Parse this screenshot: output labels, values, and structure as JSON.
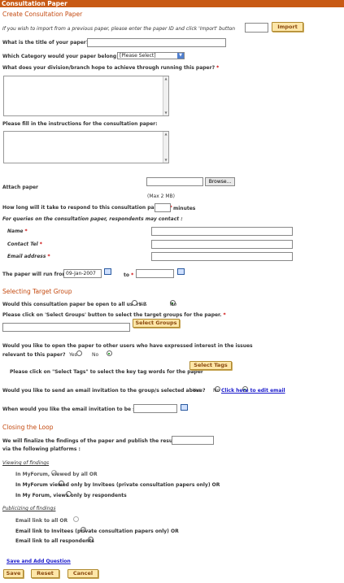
{
  "window": {
    "title": "Consultation Paper"
  },
  "header": {
    "title": "Create Consultation Paper"
  },
  "import": {
    "prompt": "If you wish to import from a previous paper, please enter the paper ID and click 'Import' button",
    "button": "Import"
  },
  "title_q": {
    "label": "What is the title of your paper?",
    "req": "*"
  },
  "category": {
    "label": "Which Category would your paper belong to?",
    "req": "*",
    "selected": "[Please Select]"
  },
  "achieve": {
    "label": "What does your division/branch hope to achieve through running this paper?",
    "req": "*"
  },
  "instructions": {
    "label": "Please fill in the instructions for the consultation paper:"
  },
  "attach": {
    "label": "Attach paper",
    "browse": "Browse...",
    "max": "(Max 2 MB)"
  },
  "respond": {
    "label": "How long will it take to respond to this consultation paper ?",
    "req": "*",
    "unit": "minutes"
  },
  "contact": {
    "intro": "For queries on the consultation paper, respondents may contact :",
    "name": "Name",
    "tel": "Contact Tel",
    "email": "Email address",
    "req": "*"
  },
  "run": {
    "from_label": "The paper will run from",
    "req": "*",
    "from_value": "09-Jan-2007",
    "to_label": "to"
  },
  "target": {
    "title": "Selecting Target Group",
    "open_q": "Would this consultation paper be open to all users ?",
    "yes": "Yes",
    "no": "No",
    "select_groups_prompt": "Please click on 'Select Groups' button to select the target groups for the paper.",
    "req": "*",
    "select_groups_btn": "Select Groups",
    "other_users_q1": "Would you like to open the paper to other users who have expressed interest in the issues",
    "other_users_q2": "relevant to this paper?",
    "select_tags_prompt": "Please click on \"Select Tags\" to select the key tag words for the paper",
    "select_tags_btn": "Select Tags",
    "email_inv_q": "Would you like to send an email invitation to the group/s selected above?",
    "edit_email": "Click here to edit email",
    "email_when": "When would you like the email invitation to be sent ?"
  },
  "closing": {
    "title": "Closing the Loop",
    "finalize_1": "We will finalize the findings of the paper and publish the results by",
    "req": "*",
    "finalize_2": "via the following platforms :",
    "viewing_title": "Viewing of findings",
    "viewing": [
      "In MyForum, viewed by all OR",
      "In MyForum viewed only by Invitees (private consultation papers only) OR",
      "In My Forum, views only by respondents"
    ],
    "publicizing_title": "Publicizing of findings",
    "publicizing": [
      "Email link to all OR",
      "Email link to Invitees (private consultation papers only) OR",
      "Email link to all respondents"
    ]
  },
  "footer": {
    "save_add": "Save and Add Question",
    "save": "Save",
    "reset": "Reset",
    "cancel": "Cancel"
  }
}
